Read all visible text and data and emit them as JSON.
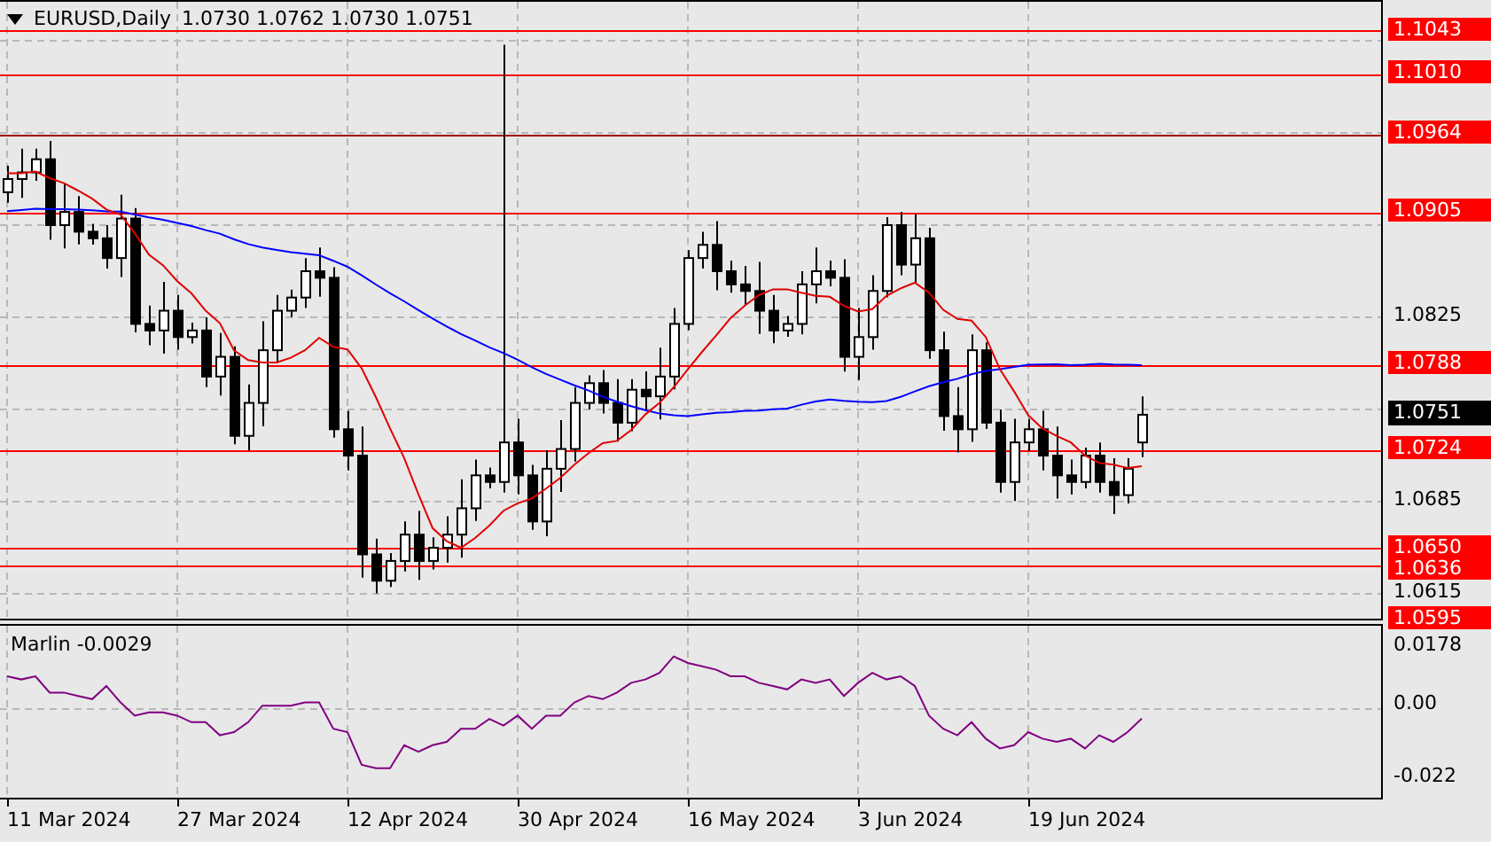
{
  "chart_header": {
    "symbol": "EURUSD,Daily",
    "ohlc": "1.0730 1.0762 1.0730 1.0751"
  },
  "price_axis": {
    "ticks": [
      "1.0825",
      "1.0685",
      "1.0615"
    ]
  },
  "levels": [
    {
      "label": "1.1043"
    },
    {
      "label": "1.1010"
    },
    {
      "label": "1.0964"
    },
    {
      "label": "1.0905"
    },
    {
      "label": "1.0788"
    },
    {
      "label": "1.0724"
    },
    {
      "label": "1.0650"
    },
    {
      "label": "1.0636"
    },
    {
      "label": "1.0595"
    }
  ],
  "current_price": {
    "label": "1.0751"
  },
  "indicator": {
    "label": "Marlin -0.0029",
    "ticks": [
      "0.0178",
      "0.00",
      "-0.022"
    ]
  },
  "time_axis": [
    "11 Mar 2024",
    "27 Mar 2024",
    "12 Apr 2024",
    "30 Apr 2024",
    "16 May 2024",
    "3 Jun 2024",
    "19 Jun 2024"
  ]
}
